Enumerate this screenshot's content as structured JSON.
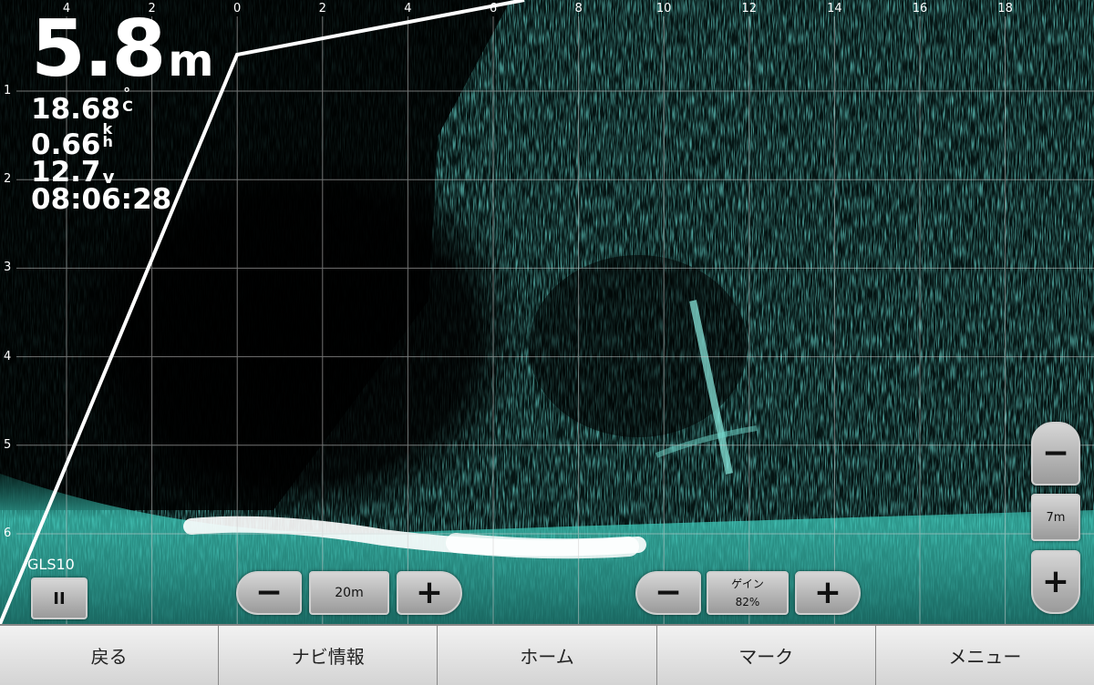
{
  "scale": {
    "top_ticks": [
      "4",
      "2",
      "0",
      "2",
      "4",
      "6",
      "8",
      "10",
      "12",
      "14",
      "16",
      "18"
    ],
    "left_ticks": [
      "1",
      "2",
      "3",
      "4",
      "5",
      "6"
    ]
  },
  "readouts": {
    "depth": "5.8",
    "depth_unit": "m",
    "temperature": "18.68",
    "temperature_unit_top": "°",
    "temperature_unit_bottom": "C",
    "speed": "0.66",
    "speed_unit_top": "k",
    "speed_unit_bottom": "h",
    "voltage": "12.7",
    "voltage_unit": "v",
    "time": "08:06:28"
  },
  "source": {
    "label": "GLS10",
    "pause_symbol": "II"
  },
  "range_control": {
    "minus": "−",
    "value": "20m",
    "plus": "+"
  },
  "gain_control": {
    "minus": "−",
    "label": "ゲイン",
    "value": "82%",
    "plus": "+"
  },
  "zoom_control": {
    "minus": "−",
    "value": "7m",
    "plus": "+"
  },
  "bottom_nav": {
    "back": "戻る",
    "navi_info": "ナビ情報",
    "home": "ホーム",
    "mark": "マーク",
    "menu": "メニュー"
  },
  "colors": {
    "sonar_return": "#2ec4b6",
    "sonar_bright": "#e8fffb",
    "water": "#000000",
    "nav_bar": "#e6e6e6"
  }
}
